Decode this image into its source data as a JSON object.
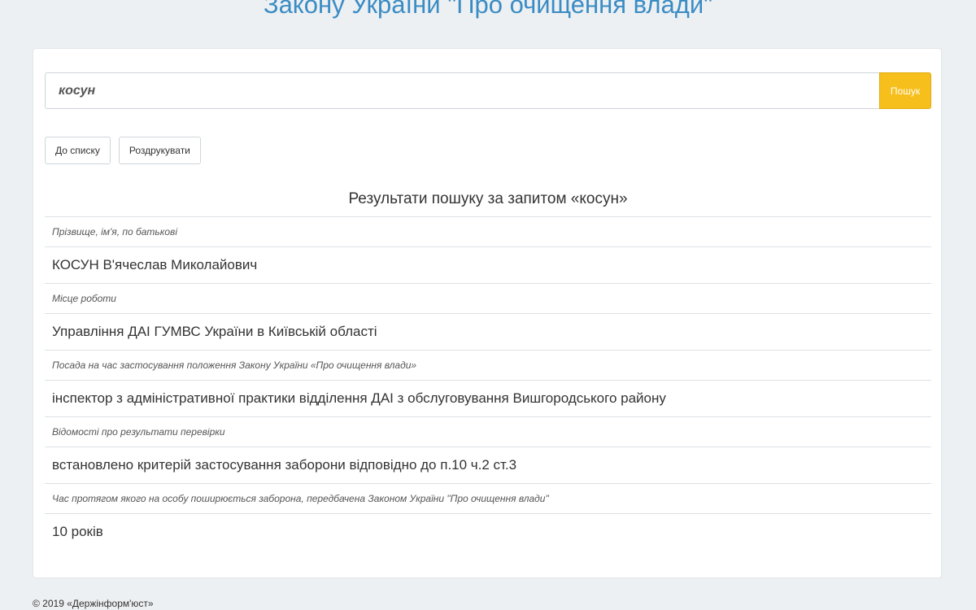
{
  "header": {
    "title": "Закону України \"Про очищення влади\""
  },
  "search": {
    "value": "косун",
    "button_label": "Пошук"
  },
  "actions": {
    "back_label": "До списку",
    "print_label": "Роздрукувати"
  },
  "results": {
    "title": "Результати пошуку за запитом «косун»",
    "fields": [
      {
        "label": "Прізвище, ім'я, по батькові",
        "value": "КОСУН В'ячеслав Миколайович"
      },
      {
        "label": "Місце роботи",
        "value": "Управління ДАІ ГУМВС України в Київській області"
      },
      {
        "label": "Посада на час застосування положення Закону України «Про очищення влади»",
        "value": "інспектор з адміністративної практики відділення ДАІ з обслуговування Вишгородського району"
      },
      {
        "label": "Відомості про результати перевірки",
        "value": "встановлено критерій застосування заборони відповідно до п.10 ч.2 ст.3"
      },
      {
        "label": "Час протягом якого на особу поширюється заборона, передбачена Законом України \"Про очищення влади\"",
        "value": "10 років"
      }
    ]
  },
  "footer": {
    "text": "© 2019 «Держінформ'юст»"
  },
  "colors": {
    "heading": "#3a8cc4",
    "search_button": "#f6bf1c",
    "background": "#edf0f2"
  }
}
